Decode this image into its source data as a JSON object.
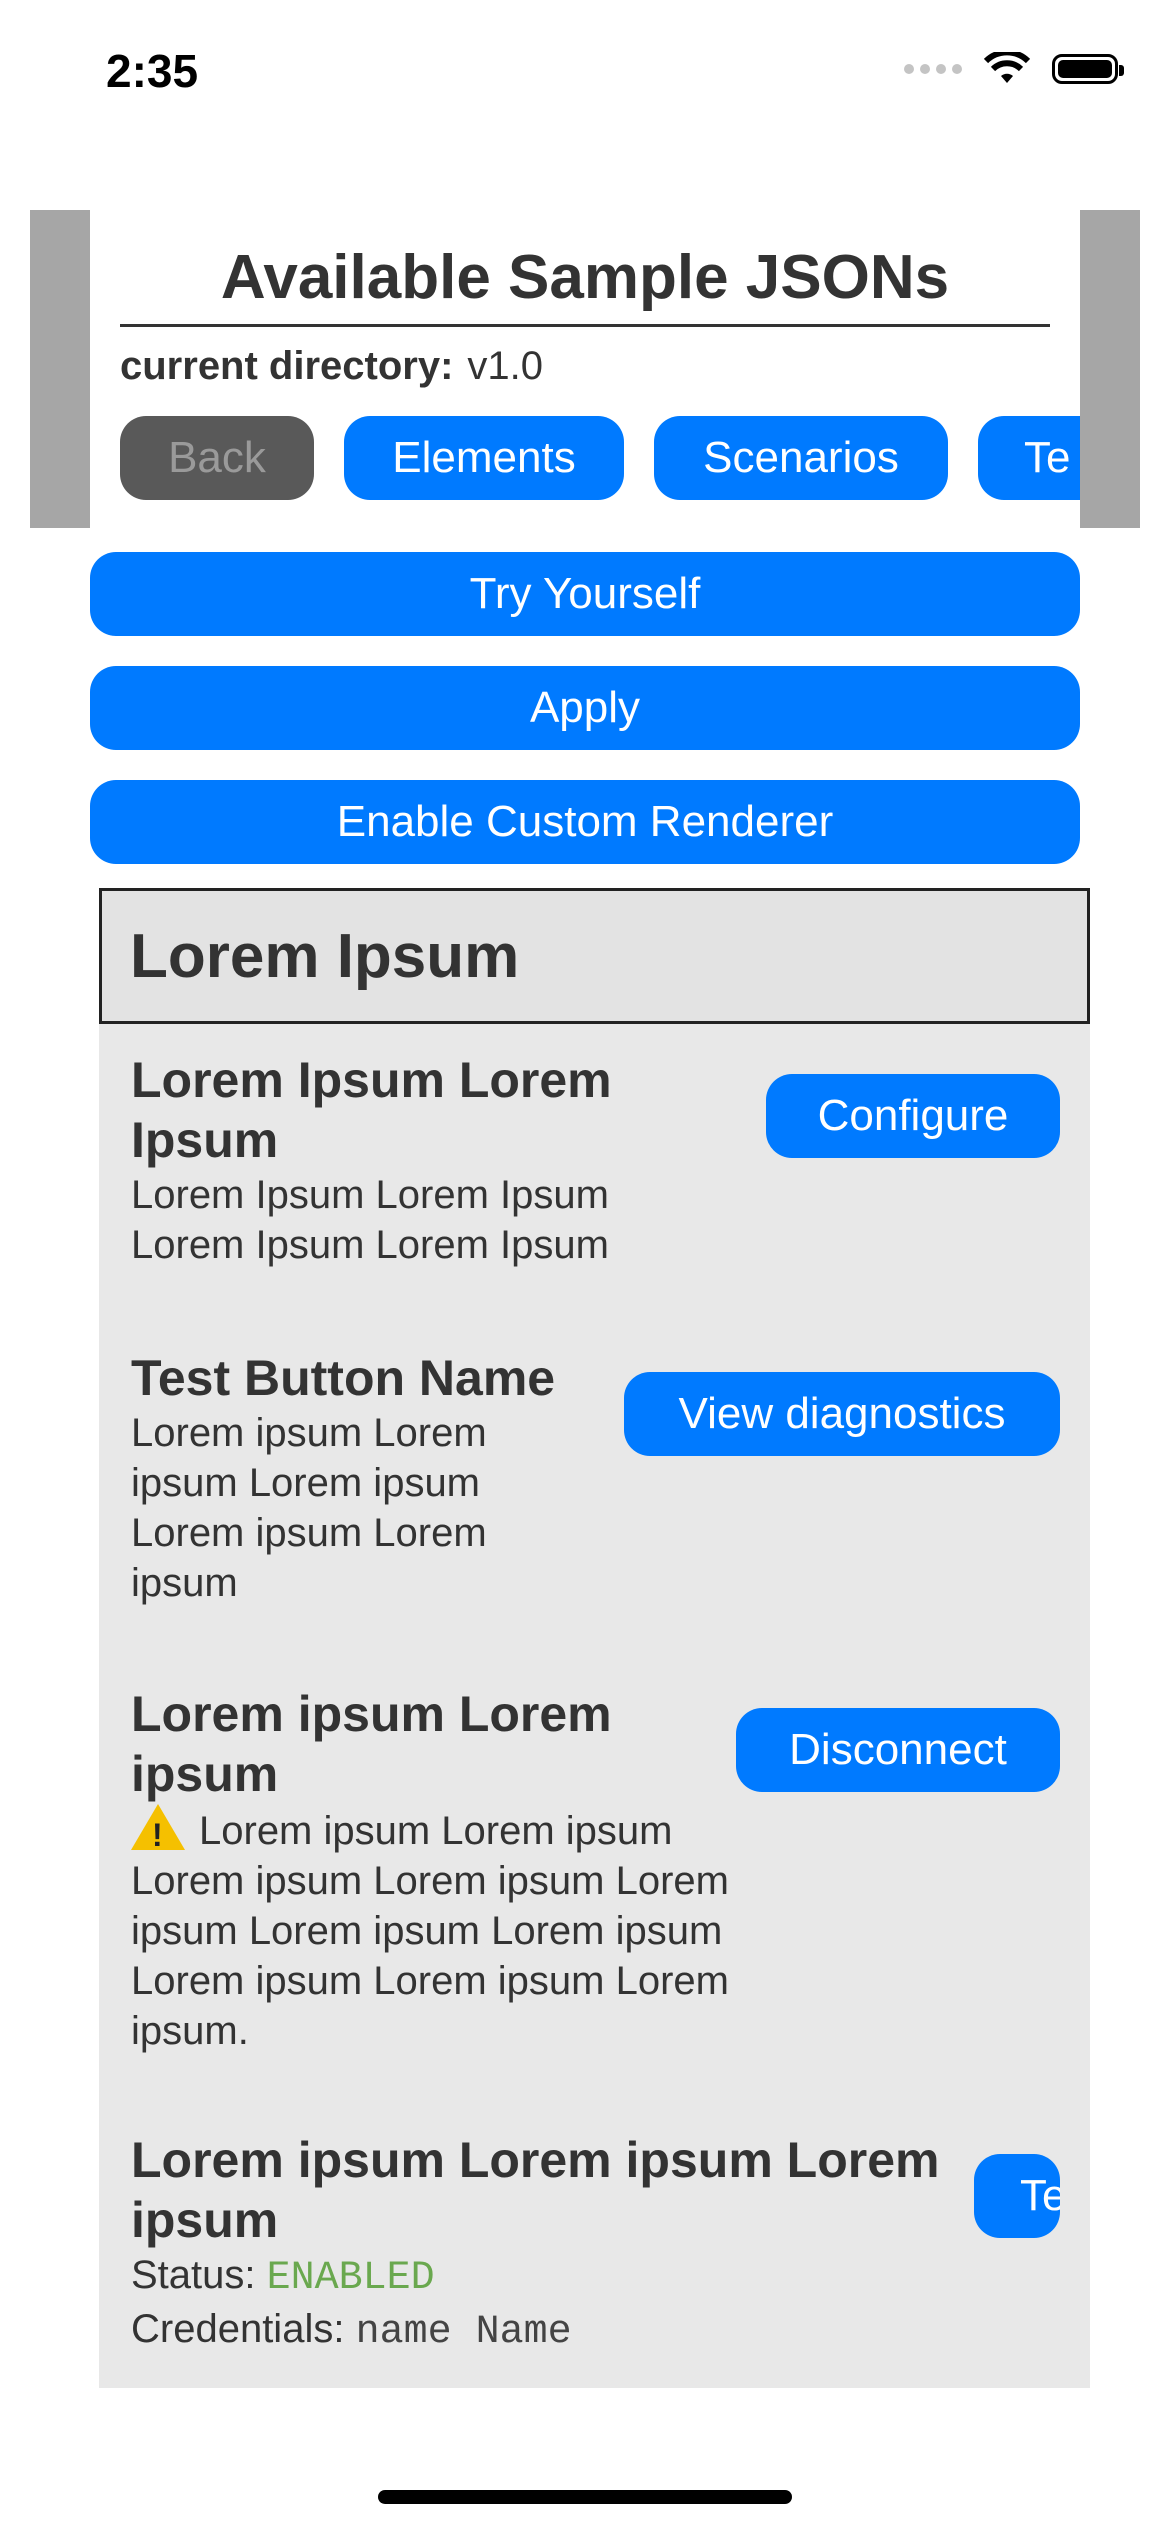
{
  "status_bar": {
    "time": "2:35",
    "signal_icon": "signal-dots-icon",
    "wifi_icon": "wifi-icon",
    "battery_icon": "battery-icon"
  },
  "header": {
    "title": "Available Sample JSONs",
    "directory_label": "current directory:",
    "directory_value": "v1.0",
    "nav": [
      "Back",
      "Elements",
      "Scenarios",
      "Te"
    ]
  },
  "actions": {
    "try_yourself": "Try Yourself",
    "apply": "Apply",
    "enable_custom_renderer": "Enable Custom Renderer"
  },
  "list": {
    "header": "Lorem Ipsum",
    "items": [
      {
        "title": "Lorem Ipsum Lorem Ipsum",
        "desc": "Lorem Ipsum Lorem Ipsum Lorem Ipsum Lorem Ipsum",
        "button": "Configure"
      },
      {
        "title": "Test Button Name",
        "desc": "Lorem ipsum Lorem ipsum Lorem ipsum Lorem ipsum Lorem ipsum",
        "button": "View diagnostics"
      },
      {
        "title": "Lorem ipsum Lorem ipsum",
        "desc": "Lorem ipsum Lorem ipsum Lorem ipsum Lorem ipsum Lorem ipsum Lorem ipsum Lorem ipsum Lorem ipsum Lorem ipsum Lorem ipsum.",
        "button": "Disconnect",
        "icon": "warning-icon"
      },
      {
        "title": "Lorem ipsum Lorem ipsum Lorem ipsum",
        "status_label": "Status:",
        "status_value": "ENABLED",
        "credentials_label": "Credentials:",
        "credentials_value": "name Name",
        "button": "Te"
      }
    ]
  },
  "colors": {
    "accent": "#007aff",
    "disabled": "#595959",
    "list_bg": "#e8e8e8",
    "header_bg": "#e3e3e3",
    "enabled": "#6aa84f",
    "warning": "#f5c000"
  }
}
